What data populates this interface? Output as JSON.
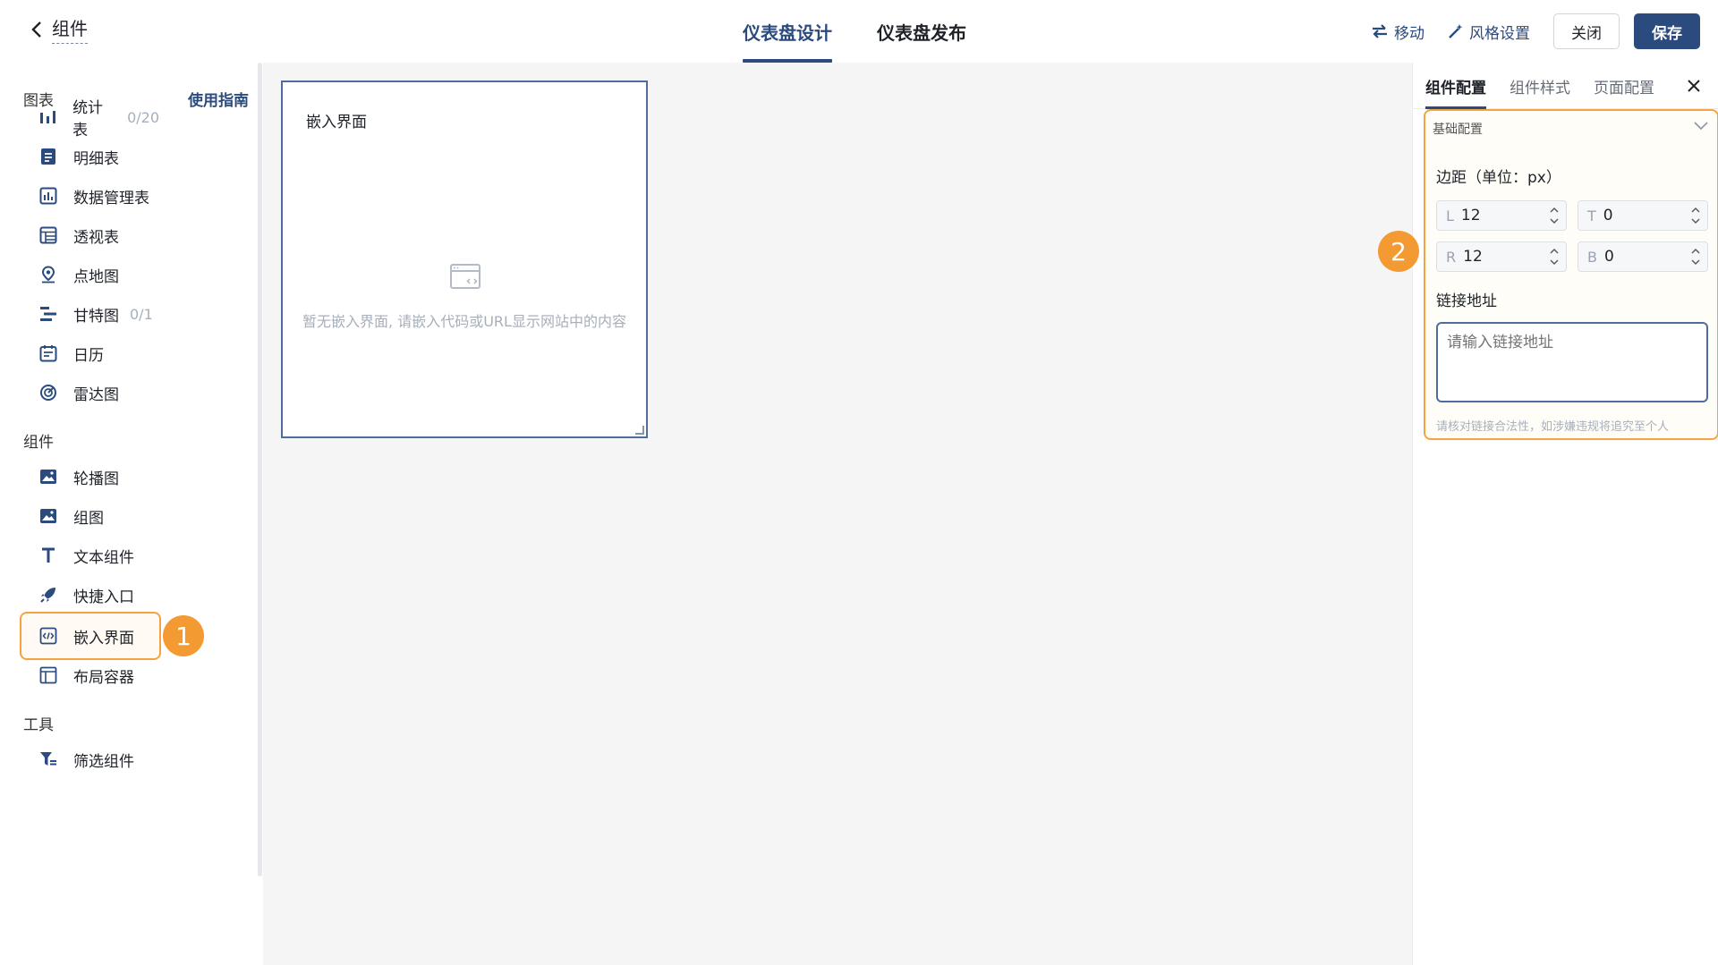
{
  "header": {
    "back_title": "组件",
    "tabs": [
      {
        "label": "仪表盘设计",
        "active": true
      },
      {
        "label": "仪表盘发布",
        "active": false
      }
    ],
    "actions": {
      "move": "移动",
      "style": "风格设置",
      "close": "关闭",
      "save": "保存"
    }
  },
  "sidebar": {
    "guide": "使用指南",
    "sections": [
      {
        "title": "图表"
      },
      {
        "title": "组件"
      },
      {
        "title": "工具"
      }
    ],
    "items": [
      {
        "label": "统计表",
        "count": "0/20",
        "icon": "bar-chart-icon"
      },
      {
        "label": "明细表",
        "count": "",
        "icon": "detail-table-icon"
      },
      {
        "label": "数据管理表",
        "count": "",
        "icon": "data-table-icon"
      },
      {
        "label": "透视表",
        "count": "",
        "icon": "pivot-table-icon"
      },
      {
        "label": "点地图",
        "count": "",
        "icon": "map-pin-icon"
      },
      {
        "label": "甘特图",
        "count": "0/1",
        "icon": "gantt-icon"
      },
      {
        "label": "日历",
        "count": "",
        "icon": "calendar-icon"
      },
      {
        "label": "雷达图",
        "count": "",
        "icon": "radar-icon"
      },
      {
        "label": "轮播图",
        "count": "",
        "icon": "image-icon"
      },
      {
        "label": "组图",
        "count": "",
        "icon": "image-icon"
      },
      {
        "label": "文本组件",
        "count": "",
        "icon": "text-icon"
      },
      {
        "label": "快捷入口",
        "count": "",
        "icon": "rocket-icon"
      },
      {
        "label": "嵌入界面",
        "count": "",
        "icon": "embed-code-icon"
      },
      {
        "label": "布局容器",
        "count": "",
        "icon": "layout-icon"
      },
      {
        "label": "筛选组件",
        "count": "",
        "icon": "filter-icon"
      }
    ],
    "selected_index": 12,
    "step_badge": "1"
  },
  "canvas": {
    "card": {
      "title": "嵌入界面",
      "empty_text": "暂无嵌入界面, 请嵌入代码或URL显示网站中的内容"
    }
  },
  "panel": {
    "tabs": [
      "组件配置",
      "组件样式",
      "页面配置"
    ],
    "active_tab": 0,
    "group_title": "基础配置",
    "margin_label": "边距（单位：px）",
    "margins": [
      {
        "prefix": "L",
        "value": "12"
      },
      {
        "prefix": "T",
        "value": "0"
      },
      {
        "prefix": "R",
        "value": "12"
      },
      {
        "prefix": "B",
        "value": "0"
      }
    ],
    "link_label": "链接地址",
    "link_placeholder": "请输入链接地址",
    "link_value": "",
    "hint": "请核对链接合法性，如涉嫌违规将追究至个人",
    "step_badge": "2"
  },
  "colors": {
    "primary": "#2b4b7e",
    "highlight": "#f5a340",
    "badge": "#f39a32",
    "canvas_bg": "#f5f5f6"
  }
}
